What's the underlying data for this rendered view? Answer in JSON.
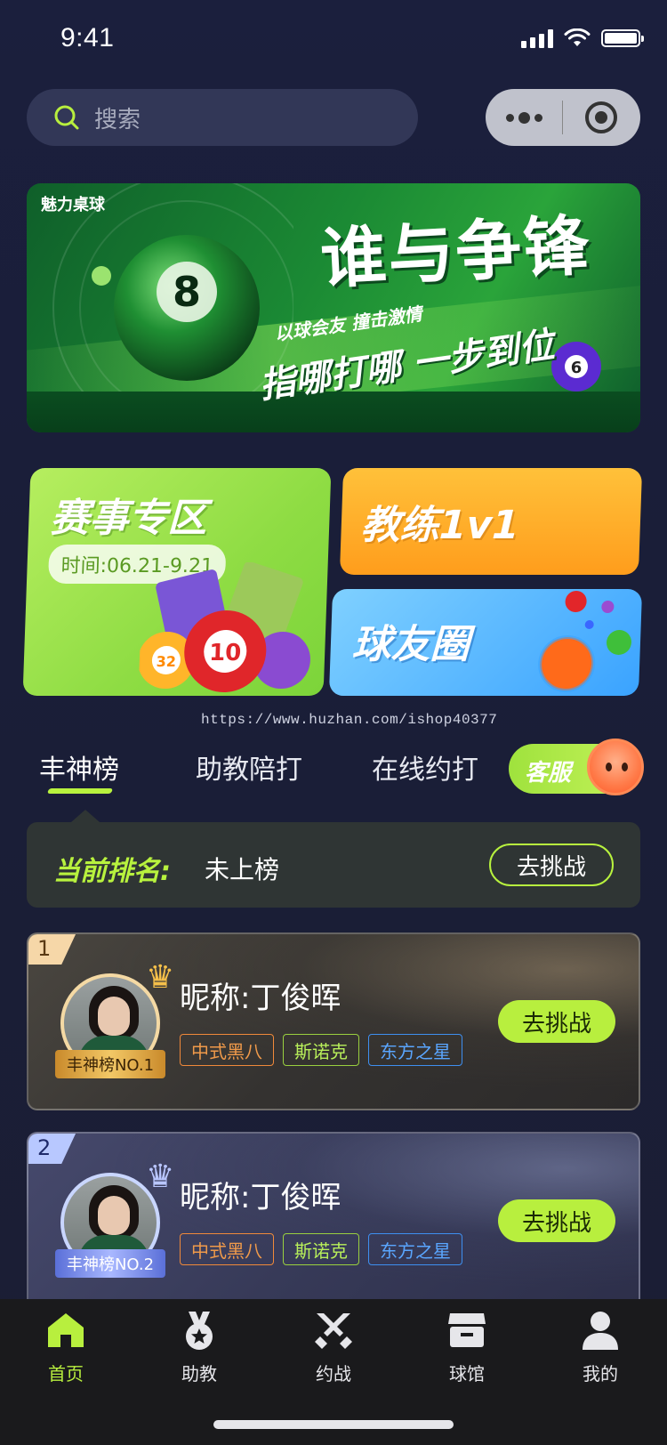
{
  "status_bar": {
    "time": "9:41"
  },
  "search": {
    "placeholder": "搜索"
  },
  "banner": {
    "logo": "魅力桌球",
    "title": "谁与争锋",
    "subtitle1": "以球会友 撞击激情",
    "subtitle2": "指哪打哪 一步到位"
  },
  "quick_cards": {
    "events": {
      "title": "赛事专区",
      "time": "时间:06.21-9.21"
    },
    "coach": {
      "title": "教练1v1"
    },
    "circle": {
      "title": "球友圈"
    }
  },
  "watermark": "https://www.huzhan.com/ishop40377",
  "tabs": [
    {
      "label": "丰神榜",
      "active": true
    },
    {
      "label": "助教陪打",
      "active": false
    },
    {
      "label": "在线约打",
      "active": false
    }
  ],
  "service": {
    "label": "客服"
  },
  "rank_status": {
    "label": "当前排名:",
    "value": "未上榜",
    "button": "去挑战"
  },
  "rank_list": [
    {
      "rank": "1",
      "nickname": "昵称:丁俊晖",
      "ribbon": "丰神榜NO.1",
      "tags": [
        "中式黑八",
        "斯诺克",
        "东方之星"
      ],
      "button": "去挑战"
    },
    {
      "rank": "2",
      "nickname": "昵称:丁俊晖",
      "ribbon": "丰神榜NO.2",
      "tags": [
        "中式黑八",
        "斯诺克",
        "东方之星"
      ],
      "button": "去挑战"
    }
  ],
  "tabbar": [
    {
      "label": "首页",
      "icon": "home-icon",
      "active": true
    },
    {
      "label": "助教",
      "icon": "medal-icon",
      "active": false
    },
    {
      "label": "约战",
      "icon": "crossed-swords-icon",
      "active": false
    },
    {
      "label": "球馆",
      "icon": "store-icon",
      "active": false
    },
    {
      "label": "我的",
      "icon": "user-icon",
      "active": false
    }
  ],
  "colors": {
    "accent": "#b8ef3e",
    "background": "#1a1e38",
    "tabbar": "#1a1a1c"
  }
}
